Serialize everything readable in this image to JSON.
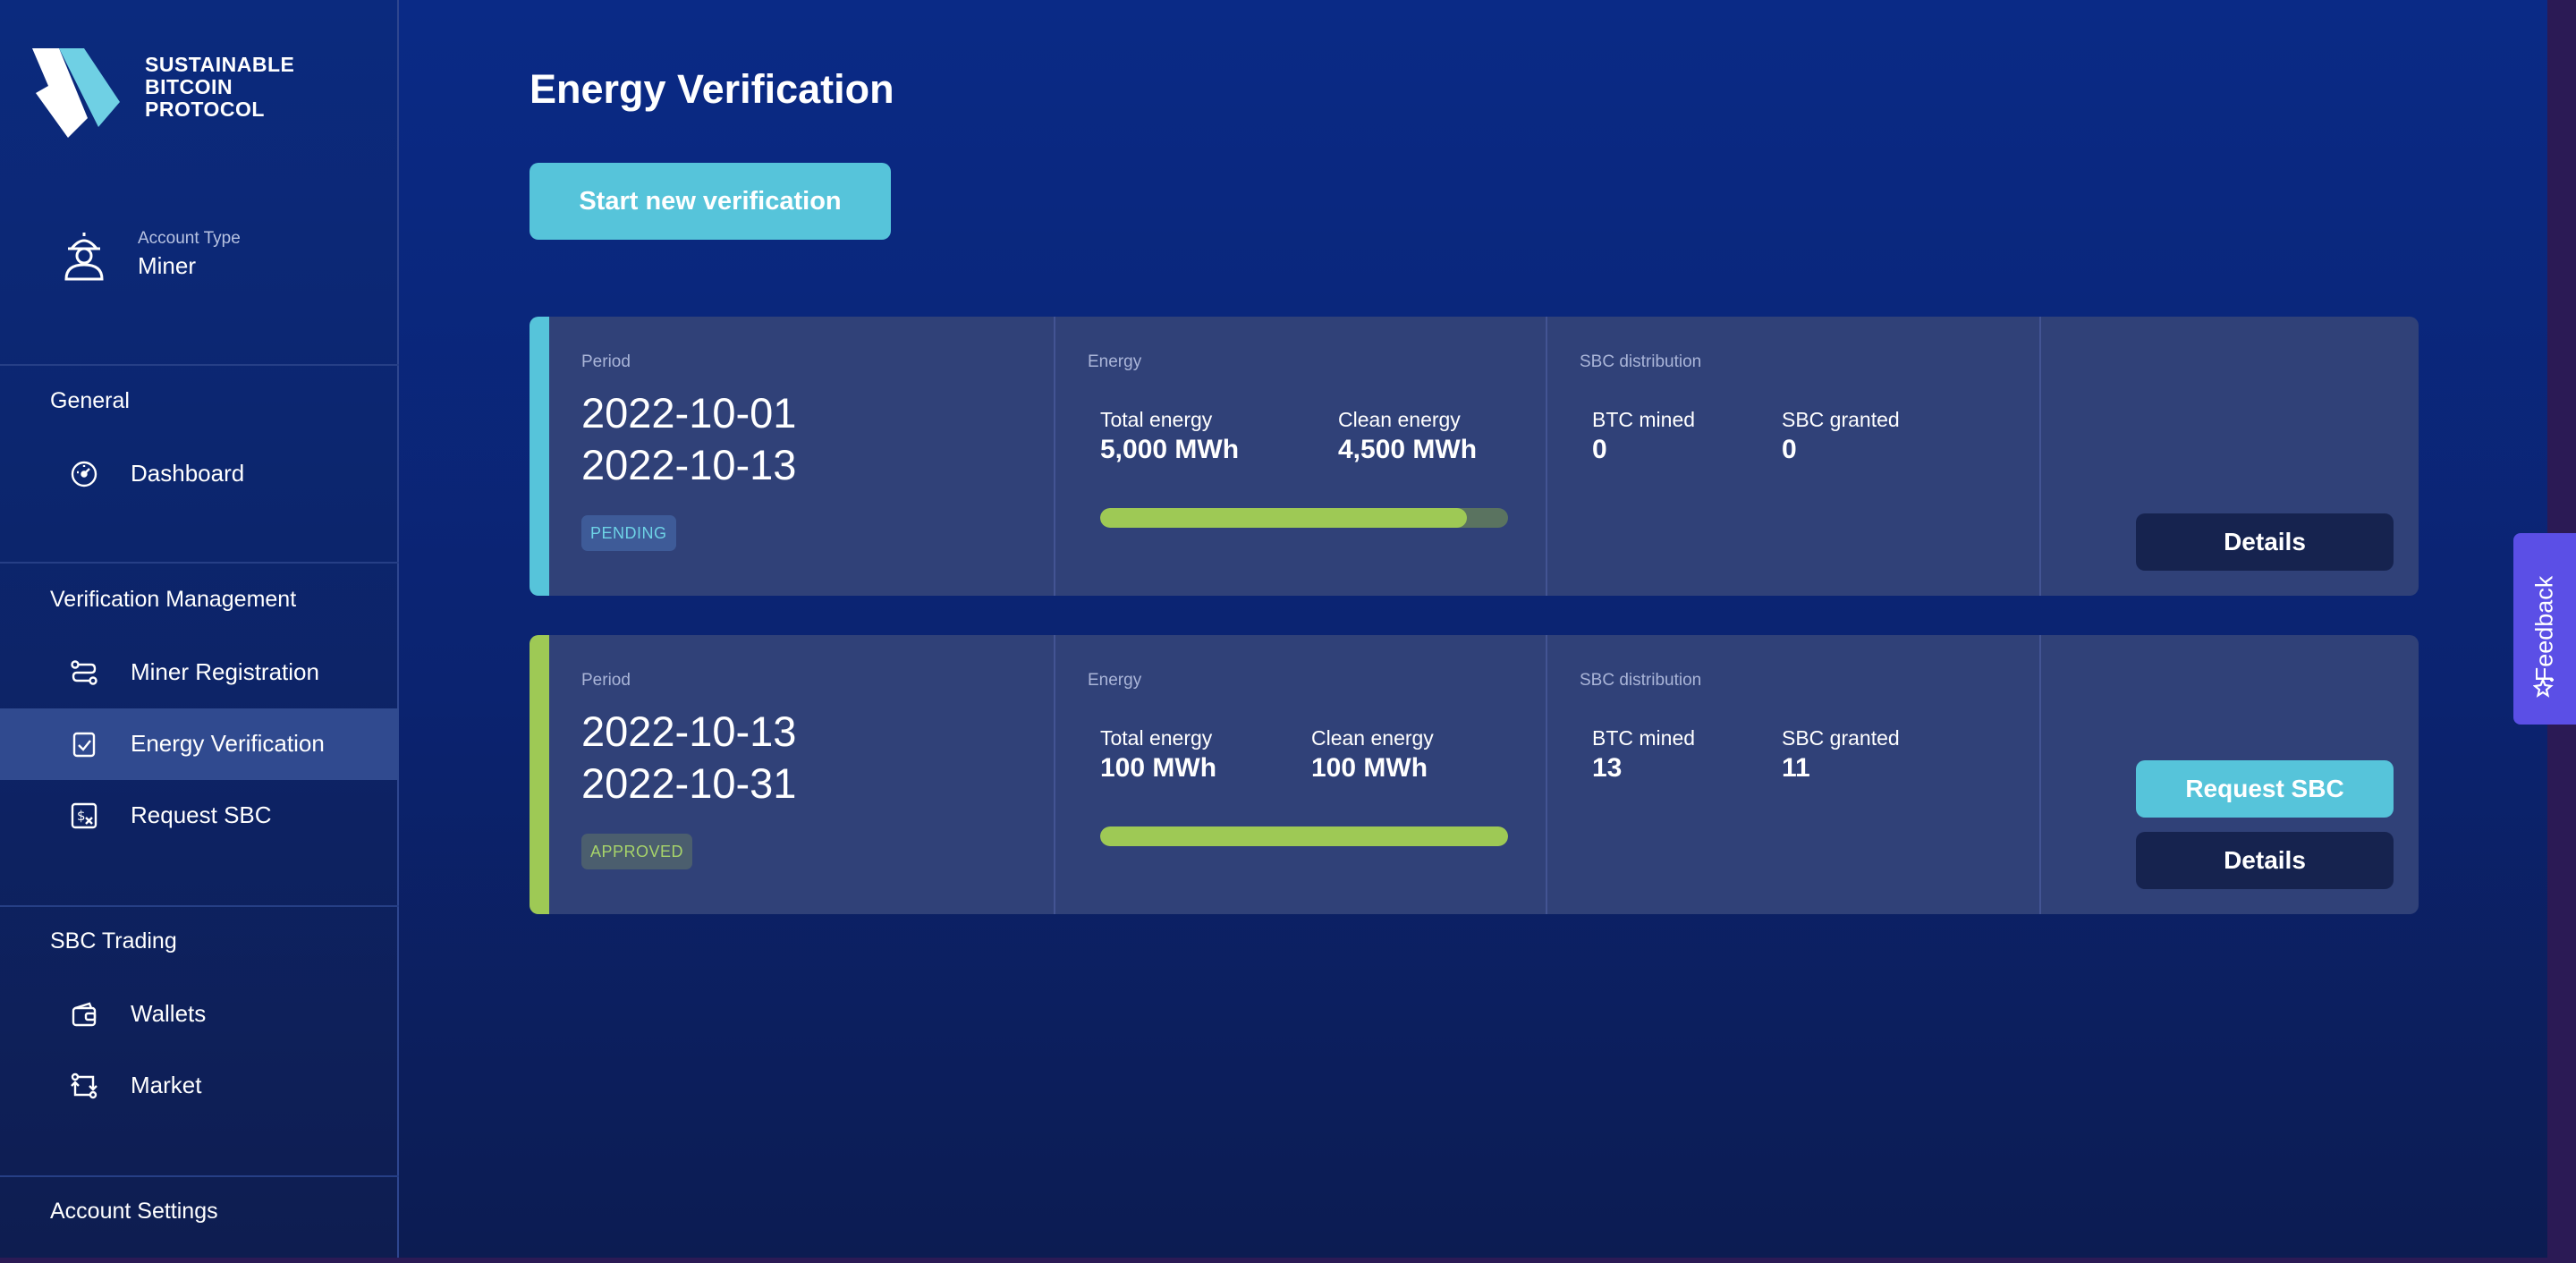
{
  "brand": {
    "name": "SUSTAINABLE\nBITCOIN\nPROTOCOL",
    "accent": "#56c4da"
  },
  "account": {
    "label": "Account Type",
    "value": "Miner",
    "icon": "miner-icon"
  },
  "sidebar": {
    "sections": [
      {
        "title": "General",
        "items": [
          {
            "label": "Dashboard",
            "icon": "dashboard-icon"
          }
        ]
      },
      {
        "title": "Verification Management",
        "items": [
          {
            "label": "Miner Registration",
            "icon": "route-icon"
          },
          {
            "label": "Energy Verification",
            "icon": "check-document-icon",
            "active": true
          },
          {
            "label": "Request SBC",
            "icon": "dollar-exchange-icon"
          }
        ]
      },
      {
        "title": "SBC Trading",
        "items": [
          {
            "label": "Wallets",
            "icon": "wallet-icon"
          },
          {
            "label": "Market",
            "icon": "market-icon"
          }
        ]
      },
      {
        "title": "Account Settings",
        "items": []
      }
    ]
  },
  "main": {
    "title": "Energy Verification",
    "start_button": "Start new verification",
    "column_labels": {
      "period": "Period",
      "energy": "Energy",
      "distribution": "SBC distribution"
    },
    "metric_labels": {
      "total_energy": "Total energy",
      "clean_energy": "Clean energy",
      "btc_mined": "BTC mined",
      "sbc_granted": "SBC granted"
    },
    "cards": [
      {
        "period_start": "2022-10-01",
        "period_end": "2022-10-13",
        "status": "PENDING",
        "stripe_color": "#56c4da",
        "total_energy": "5,000 MWh",
        "clean_energy": "4,500 MWh",
        "clean_fraction": 0.9,
        "btc_mined": "0",
        "sbc_granted": "0",
        "details_label": "Details"
      },
      {
        "period_start": "2022-10-13",
        "period_end": "2022-10-31",
        "status": "APPROVED",
        "stripe_color": "#9ec955",
        "total_energy": "100 MWh",
        "clean_energy": "100 MWh",
        "clean_fraction": 1.0,
        "btc_mined": "13",
        "sbc_granted": "11",
        "request_label": "Request SBC",
        "details_label": "Details"
      }
    ]
  },
  "feedback": {
    "label": "Feedback",
    "color": "#5b4fe6"
  }
}
